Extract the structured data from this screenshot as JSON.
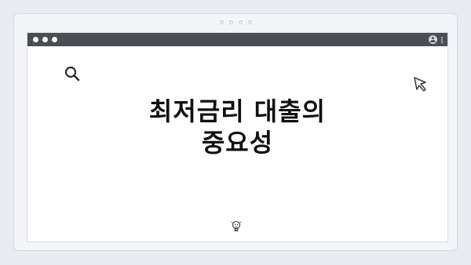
{
  "frame": {
    "page_indicator_count": 4
  },
  "window": {
    "traffic_lights": [
      "close",
      "minimize",
      "maximize"
    ],
    "titlebar_color": "#4a4d55",
    "icons": {
      "account": "user-icon",
      "menu": "kebab-menu-icon",
      "search": "search-icon",
      "cursor": "cursor-icon",
      "bulb": "lightbulb-icon"
    }
  },
  "headline": {
    "line1": "최저금리 대출의",
    "line2": "중요성"
  }
}
